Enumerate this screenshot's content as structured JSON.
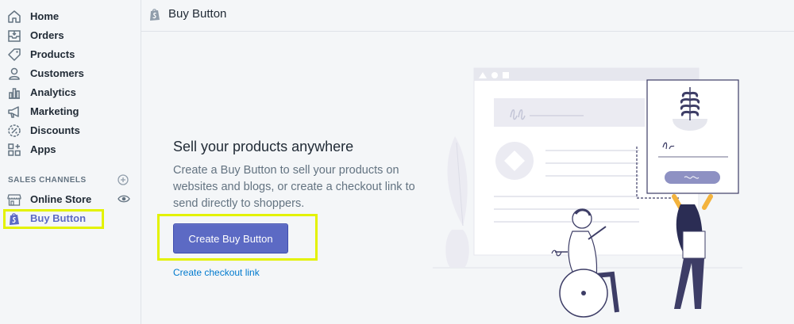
{
  "sidebar": {
    "items": [
      {
        "label": "Home"
      },
      {
        "label": "Orders"
      },
      {
        "label": "Products"
      },
      {
        "label": "Customers"
      },
      {
        "label": "Analytics"
      },
      {
        "label": "Marketing"
      },
      {
        "label": "Discounts"
      },
      {
        "label": "Apps"
      }
    ],
    "sales_channels_heading": "SALES CHANNELS",
    "channels": [
      {
        "label": "Online Store"
      },
      {
        "label": "Buy Button"
      }
    ]
  },
  "header": {
    "title": "Buy Button"
  },
  "main": {
    "heading": "Sell your products anywhere",
    "description": "Create a Buy Button to sell your products on websites and blogs, or create a checkout link to send directly to shoppers.",
    "primary_button": "Create Buy Button",
    "secondary_link": "Create checkout link"
  },
  "colors": {
    "accent": "#5c6ac4",
    "link": "#007ace",
    "highlight": "#e3f200"
  }
}
